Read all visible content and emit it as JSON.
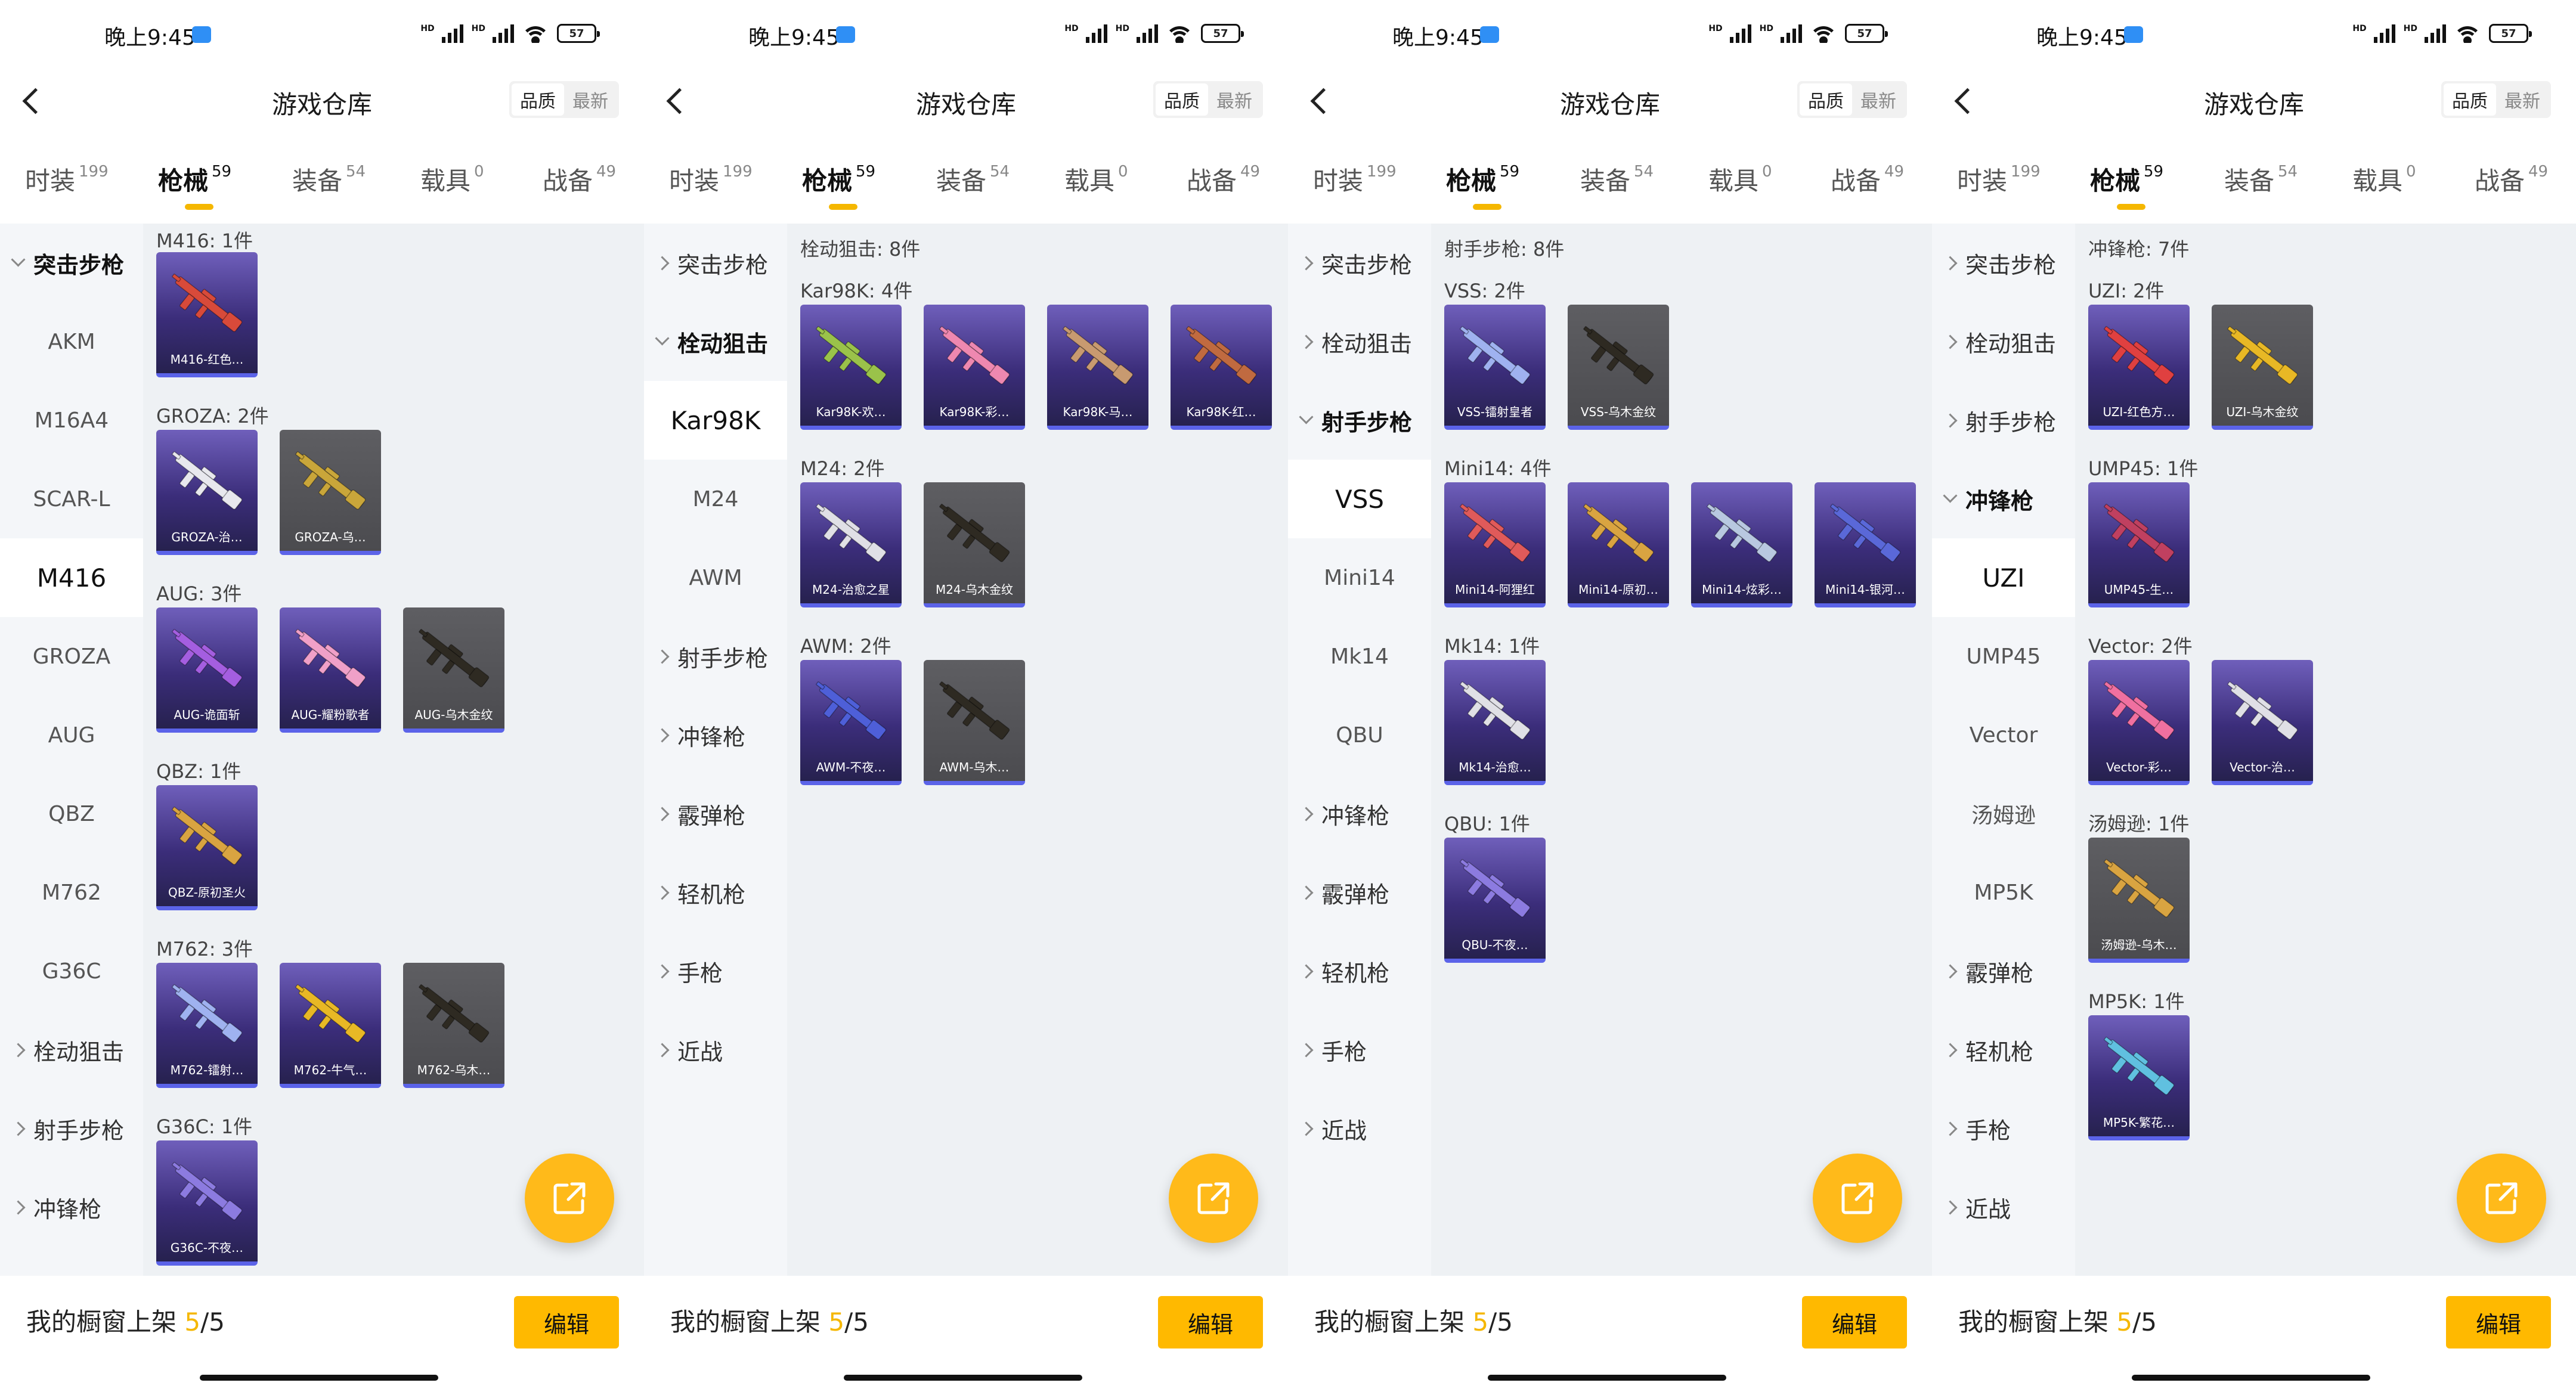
{
  "screens": [
    {
      "id": "s1",
      "status": {
        "time": "晚上9:45",
        "battery": "57"
      },
      "header": {
        "title": "游戏仓库",
        "sort_options": [
          "品质",
          "最新"
        ],
        "sort_active": 0
      },
      "tabs": [
        {
          "label": "时装",
          "count": "199"
        },
        {
          "label": "枪械",
          "count": "59",
          "active": true
        },
        {
          "label": "装备",
          "count": "54"
        },
        {
          "label": "载具",
          "count": "0"
        },
        {
          "label": "战备",
          "count": "49"
        }
      ],
      "sidebar": [
        {
          "label": "突击步枪",
          "type": "group",
          "open": true
        },
        {
          "label": "AKM"
        },
        {
          "label": "M16A4"
        },
        {
          "label": "SCAR-L"
        },
        {
          "label": "M416",
          "selected": true
        },
        {
          "label": "GROZA"
        },
        {
          "label": "AUG"
        },
        {
          "label": "QBZ"
        },
        {
          "label": "M762"
        },
        {
          "label": "G36C"
        },
        {
          "label": "栓动狙击",
          "type": "group"
        },
        {
          "label": "射手步枪",
          "type": "group"
        },
        {
          "label": "冲锋枪",
          "type": "group"
        }
      ],
      "content_header": "",
      "groups": [
        {
          "label": "M416: 1件",
          "items": [
            {
              "name": "M416-红色…",
              "color": "#d84a3a"
            }
          ]
        },
        {
          "label": "GROZA: 2件",
          "items": [
            {
              "name": "GROZA-治…",
              "color": "#e8e8ee"
            },
            {
              "name": "GROZA-乌…",
              "color": "#c9a63a",
              "gray": true
            }
          ]
        },
        {
          "label": "AUG: 3件",
          "items": [
            {
              "name": "AUG-诡面斩",
              "color": "#a45ee0"
            },
            {
              "name": "AUG-耀粉歌者",
              "color": "#f0a0c8"
            },
            {
              "name": "AUG-乌木金纹",
              "color": "#2e2a22",
              "gray": true
            }
          ]
        },
        {
          "label": "QBZ: 1件",
          "items": [
            {
              "name": "QBZ-原初圣火",
              "color": "#d9a441"
            }
          ]
        },
        {
          "label": "M762: 3件",
          "items": [
            {
              "name": "M762-镭射…",
              "color": "#9fb2f0"
            },
            {
              "name": "M762-牛气…",
              "color": "#e8b825"
            },
            {
              "name": "M762-乌木…",
              "color": "#2e2a22",
              "gray": true
            }
          ]
        },
        {
          "label": "G36C: 1件",
          "items": [
            {
              "name": "G36C-不夜…",
              "color": "#8c7be0"
            }
          ]
        }
      ],
      "bottom": {
        "label": "我的橱窗上架",
        "used": "5",
        "total": "/5",
        "edit": "编辑"
      }
    },
    {
      "id": "s2",
      "status": {
        "time": "晚上9:45",
        "battery": "57"
      },
      "header": {
        "title": "游戏仓库",
        "sort_options": [
          "品质",
          "最新"
        ],
        "sort_active": 0
      },
      "tabs": [
        {
          "label": "时装",
          "count": "199"
        },
        {
          "label": "枪械",
          "count": "59",
          "active": true
        },
        {
          "label": "装备",
          "count": "54"
        },
        {
          "label": "载具",
          "count": "0"
        },
        {
          "label": "战备",
          "count": "49"
        }
      ],
      "sidebar": [
        {
          "label": "突击步枪",
          "type": "group"
        },
        {
          "label": "栓动狙击",
          "type": "group",
          "open": true
        },
        {
          "label": "Kar98K",
          "selected": true
        },
        {
          "label": "M24"
        },
        {
          "label": "AWM"
        },
        {
          "label": "射手步枪",
          "type": "group"
        },
        {
          "label": "冲锋枪",
          "type": "group"
        },
        {
          "label": "霰弹枪",
          "type": "group"
        },
        {
          "label": "轻机枪",
          "type": "group"
        },
        {
          "label": "手枪",
          "type": "group"
        },
        {
          "label": "近战",
          "type": "group"
        }
      ],
      "content_header": "栓动狙击: 8件",
      "groups": [
        {
          "label": "Kar98K: 4件",
          "items": [
            {
              "name": "Kar98K-欢…",
              "color": "#9ac24a"
            },
            {
              "name": "Kar98K-彩…",
              "color": "#ee88b0"
            },
            {
              "name": "Kar98K-马…",
              "color": "#c89a70"
            },
            {
              "name": "Kar98K-红…",
              "color": "#c06a40"
            }
          ]
        },
        {
          "label": "M24: 2件",
          "items": [
            {
              "name": "M24-治愈之星",
              "color": "#e0e0e6"
            },
            {
              "name": "M24-乌木金纹",
              "color": "#2e2a22",
              "gray": true
            }
          ]
        },
        {
          "label": "AWM: 2件",
          "items": [
            {
              "name": "AWM-不夜…",
              "color": "#4e5fd8"
            },
            {
              "name": "AWM-乌木…",
              "color": "#2e2a22",
              "gray": true
            }
          ]
        }
      ],
      "bottom": {
        "label": "我的橱窗上架",
        "used": "5",
        "total": "/5",
        "edit": "编辑"
      }
    },
    {
      "id": "s3",
      "status": {
        "time": "晚上9:45",
        "battery": "57"
      },
      "header": {
        "title": "游戏仓库",
        "sort_options": [
          "品质",
          "最新"
        ],
        "sort_active": 0
      },
      "tabs": [
        {
          "label": "时装",
          "count": "199"
        },
        {
          "label": "枪械",
          "count": "59",
          "active": true
        },
        {
          "label": "装备",
          "count": "54"
        },
        {
          "label": "载具",
          "count": "0"
        },
        {
          "label": "战备",
          "count": "49"
        }
      ],
      "sidebar": [
        {
          "label": "突击步枪",
          "type": "group"
        },
        {
          "label": "栓动狙击",
          "type": "group"
        },
        {
          "label": "射手步枪",
          "type": "group",
          "open": true
        },
        {
          "label": "VSS",
          "selected": true
        },
        {
          "label": "Mini14"
        },
        {
          "label": "Mk14"
        },
        {
          "label": "QBU"
        },
        {
          "label": "冲锋枪",
          "type": "group"
        },
        {
          "label": "霰弹枪",
          "type": "group"
        },
        {
          "label": "轻机枪",
          "type": "group"
        },
        {
          "label": "手枪",
          "type": "group"
        },
        {
          "label": "近战",
          "type": "group"
        }
      ],
      "content_header": "射手步枪: 8件",
      "groups": [
        {
          "label": "VSS: 2件",
          "items": [
            {
              "name": "VSS-镭射皇者",
              "color": "#9fb2f0"
            },
            {
              "name": "VSS-乌木金纹",
              "color": "#2e2a22",
              "gray": true
            }
          ]
        },
        {
          "label": "Mini14: 4件",
          "items": [
            {
              "name": "Mini14-阿狸红",
              "color": "#e05a5a"
            },
            {
              "name": "Mini14-原初…",
              "color": "#d9a441"
            },
            {
              "name": "Mini14-炫彩…",
              "color": "#b8c8e0"
            },
            {
              "name": "Mini14-银河…",
              "color": "#5a68d8"
            }
          ]
        },
        {
          "label": "Mk14: 1件",
          "items": [
            {
              "name": "Mk14-治愈…",
              "color": "#e0e0e6"
            }
          ]
        },
        {
          "label": "QBU: 1件",
          "items": [
            {
              "name": "QBU-不夜…",
              "color": "#8c7be0"
            }
          ]
        }
      ],
      "bottom": {
        "label": "我的橱窗上架",
        "used": "5",
        "total": "/5",
        "edit": "编辑"
      }
    },
    {
      "id": "s4",
      "status": {
        "time": "晚上9:45",
        "battery": "57"
      },
      "header": {
        "title": "游戏仓库",
        "sort_options": [
          "品质",
          "最新"
        ],
        "sort_active": 0
      },
      "tabs": [
        {
          "label": "时装",
          "count": "199"
        },
        {
          "label": "枪械",
          "count": "59",
          "active": true
        },
        {
          "label": "装备",
          "count": "54"
        },
        {
          "label": "载具",
          "count": "0"
        },
        {
          "label": "战备",
          "count": "49"
        }
      ],
      "sidebar": [
        {
          "label": "突击步枪",
          "type": "group"
        },
        {
          "label": "栓动狙击",
          "type": "group"
        },
        {
          "label": "射手步枪",
          "type": "group"
        },
        {
          "label": "冲锋枪",
          "type": "group",
          "open": true
        },
        {
          "label": "UZI",
          "selected": true
        },
        {
          "label": "UMP45"
        },
        {
          "label": "Vector"
        },
        {
          "label": "汤姆逊"
        },
        {
          "label": "MP5K"
        },
        {
          "label": "霰弹枪",
          "type": "group"
        },
        {
          "label": "轻机枪",
          "type": "group"
        },
        {
          "label": "手枪",
          "type": "group"
        },
        {
          "label": "近战",
          "type": "group"
        }
      ],
      "content_header": "冲锋枪: 7件",
      "groups": [
        {
          "label": "UZI: 2件",
          "items": [
            {
              "name": "UZI-红色方…",
              "color": "#e04040"
            },
            {
              "name": "UZI-乌木金纹",
              "color": "#e8b825",
              "gray": true
            }
          ]
        },
        {
          "label": "UMP45: 1件",
          "items": [
            {
              "name": "UMP45-生…",
              "color": "#c04060"
            }
          ]
        },
        {
          "label": "Vector: 2件",
          "items": [
            {
              "name": "Vector-彩…",
              "color": "#f070a0"
            },
            {
              "name": "Vector-治…",
              "color": "#e0e0e6"
            }
          ]
        },
        {
          "label": "汤姆逊: 1件",
          "items": [
            {
              "name": "汤姆逊-乌木…",
              "color": "#d9a441",
              "gray": true
            }
          ]
        },
        {
          "label": "MP5K: 1件",
          "items": [
            {
              "name": "MP5K-繁花…",
              "color": "#60c0e0"
            }
          ]
        }
      ],
      "bottom": {
        "label": "我的橱窗上架",
        "used": "5",
        "total": "/5",
        "edit": "编辑"
      }
    }
  ]
}
